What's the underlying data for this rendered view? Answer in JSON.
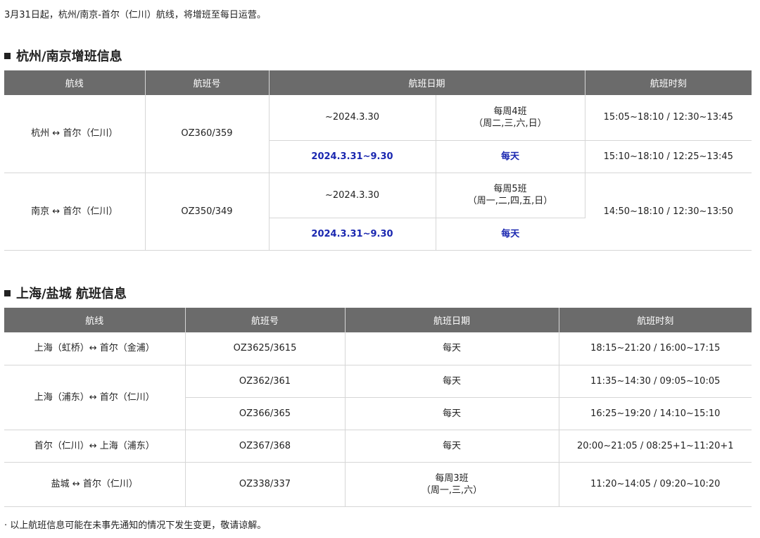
{
  "intro_text": "3月31日起，杭州/南京-首尔（仁川）航线，将增班至每日运营。",
  "section1": {
    "title": "杭州/南京增班信息",
    "headers": [
      "航线",
      "航班号",
      "航班日期",
      "航班时刻"
    ],
    "routes": [
      {
        "route": "杭州 ↔ 首尔（仁川）",
        "flight_no": "OZ360/359",
        "periods": [
          {
            "date": "~2024.3.30",
            "freq_line1": "每周4班",
            "freq_line2": "（周二,三,六,日）",
            "time": "15:05~18:10 / 12:30~13:45"
          },
          {
            "date": "2024.3.31~9.30",
            "freq_line1": "每天",
            "time": "15:10~18:10 / 12:25~13:45"
          }
        ]
      },
      {
        "route": "南京 ↔ 首尔（仁川）",
        "flight_no": "OZ350/349",
        "periods": [
          {
            "date": "~2024.3.30",
            "freq_line1": "每周5班",
            "freq_line2": "（周一,二,四,五,日）"
          },
          {
            "date": "2024.3.31~9.30",
            "freq_line1": "每天"
          }
        ],
        "time": "14:50~18:10 / 12:30~13:50"
      }
    ]
  },
  "section2": {
    "title": "上海/盐城 航班信息",
    "headers": [
      "航线",
      "航班号",
      "航班日期",
      "航班时刻"
    ],
    "rows": [
      {
        "route": "上海（虹桥）↔ 首尔（金浦）",
        "flight_no": "OZ3625/3615",
        "date": "每天",
        "time": "18:15~21:20 / 16:00~17:15"
      },
      {
        "route": "上海（浦东）↔ 首尔（仁川）",
        "flight_no": "OZ362/361",
        "date": "每天",
        "time": "11:35~14:30 / 09:05~10:05"
      },
      {
        "flight_no": "OZ366/365",
        "date": "每天",
        "time": "16:25~19:20 / 14:10~15:10"
      },
      {
        "route": "首尔（仁川）↔ 上海（浦东）",
        "flight_no": "OZ367/368",
        "date": "每天",
        "time": "20:00~21:05 / 08:25+1~11:20+1"
      },
      {
        "route": "盐城 ↔ 首尔（仁川）",
        "flight_no": "OZ338/337",
        "date_line1": "每周3班",
        "date_line2": "（周一,三,六）",
        "time": "11:20~14:05 / 09:20~10:20"
      }
    ]
  },
  "footnote": "· 以上航班信息可能在未事先通知的情况下发生变更，敬请谅解。"
}
